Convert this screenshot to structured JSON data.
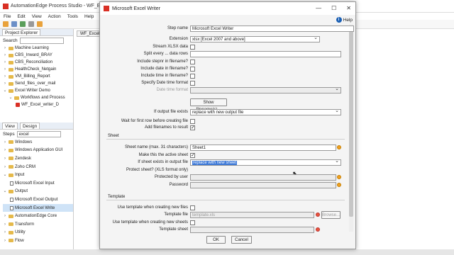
{
  "app": {
    "title": "AutomationEdge Process Studio - WF_Excel_writer_Demo",
    "menu": [
      "File",
      "Edit",
      "View",
      "Action",
      "Tools",
      "Help"
    ]
  },
  "left_panel": {
    "project_tab": "Project Explorer",
    "search_label": "Search",
    "tree": [
      "Machine Learning",
      "CBS_Inward_BRAY",
      "CBS_Reconciliation",
      "HealthCheck_Netgain",
      "VM_Billing_Report",
      "Send_files_over_mail",
      "Excel Writer Demo",
      "Workflows and Process",
      "WF_Excel_writer_D"
    ],
    "view_tab": "View",
    "design_tab": "Design",
    "steps_label": "Steps",
    "steps_search_value": "excel",
    "steps_tree": [
      "Windows",
      "Windows Application GUI",
      "Zendesk",
      "Zoho CRM",
      "Input",
      "Microsoft Excel Input",
      "Output",
      "Microsoft Excel Output",
      "Microsoft Excel Write",
      "AutomationEdge Core",
      "Transform",
      "Utility",
      "Flow"
    ]
  },
  "canvas": {
    "tab": "WF_Excel_writer_"
  },
  "dialog": {
    "title": "Microsoft Excel Writer",
    "help": "Help",
    "step_name_label": "Step name",
    "step_name_value": "Microsoft Excel Writer",
    "extension_label": "Extension",
    "extension_value": "xlsx [Excel 2007 and above]",
    "stream_label": "Stream XLSX data",
    "split_label": "Split every ... data rows",
    "stepnr_label": "Include stepnr in filename?",
    "date_label": "Include date in filename?",
    "time_label": "Include time in filename?",
    "date_format_label": "Specify Date time format",
    "date_time_format_label": "Date time format",
    "show_filenames": "Show filename(s)...",
    "if_exists_label": "If output file exists",
    "if_exists_value": "replace with new output file",
    "wait_label": "Wait for first row before creating file",
    "add_filenames_label": "Add filenames to result",
    "sheet_section": "Sheet",
    "sheet_name_label": "Sheet name (max. 31 characters)",
    "sheet_name_value": "Sheet1",
    "active_sheet_label": "Make this the active sheet",
    "sheet_exists_label": "If sheet exists in output file",
    "sheet_exists_value": "replace with new sheet",
    "protect_label": "Protect sheet? (XLS format only)",
    "protected_by_label": "Protected by user",
    "password_label": "Password",
    "template_section": "Template",
    "use_template_files_label": "Use template when creating new files",
    "template_file_label": "Template file",
    "template_file_value": "template.xls",
    "browse": "Browse...",
    "use_template_sheets_label": "Use template when creating new sheets",
    "template_sheet_label": "Template sheet",
    "ok": "OK",
    "cancel": "Cancel"
  }
}
